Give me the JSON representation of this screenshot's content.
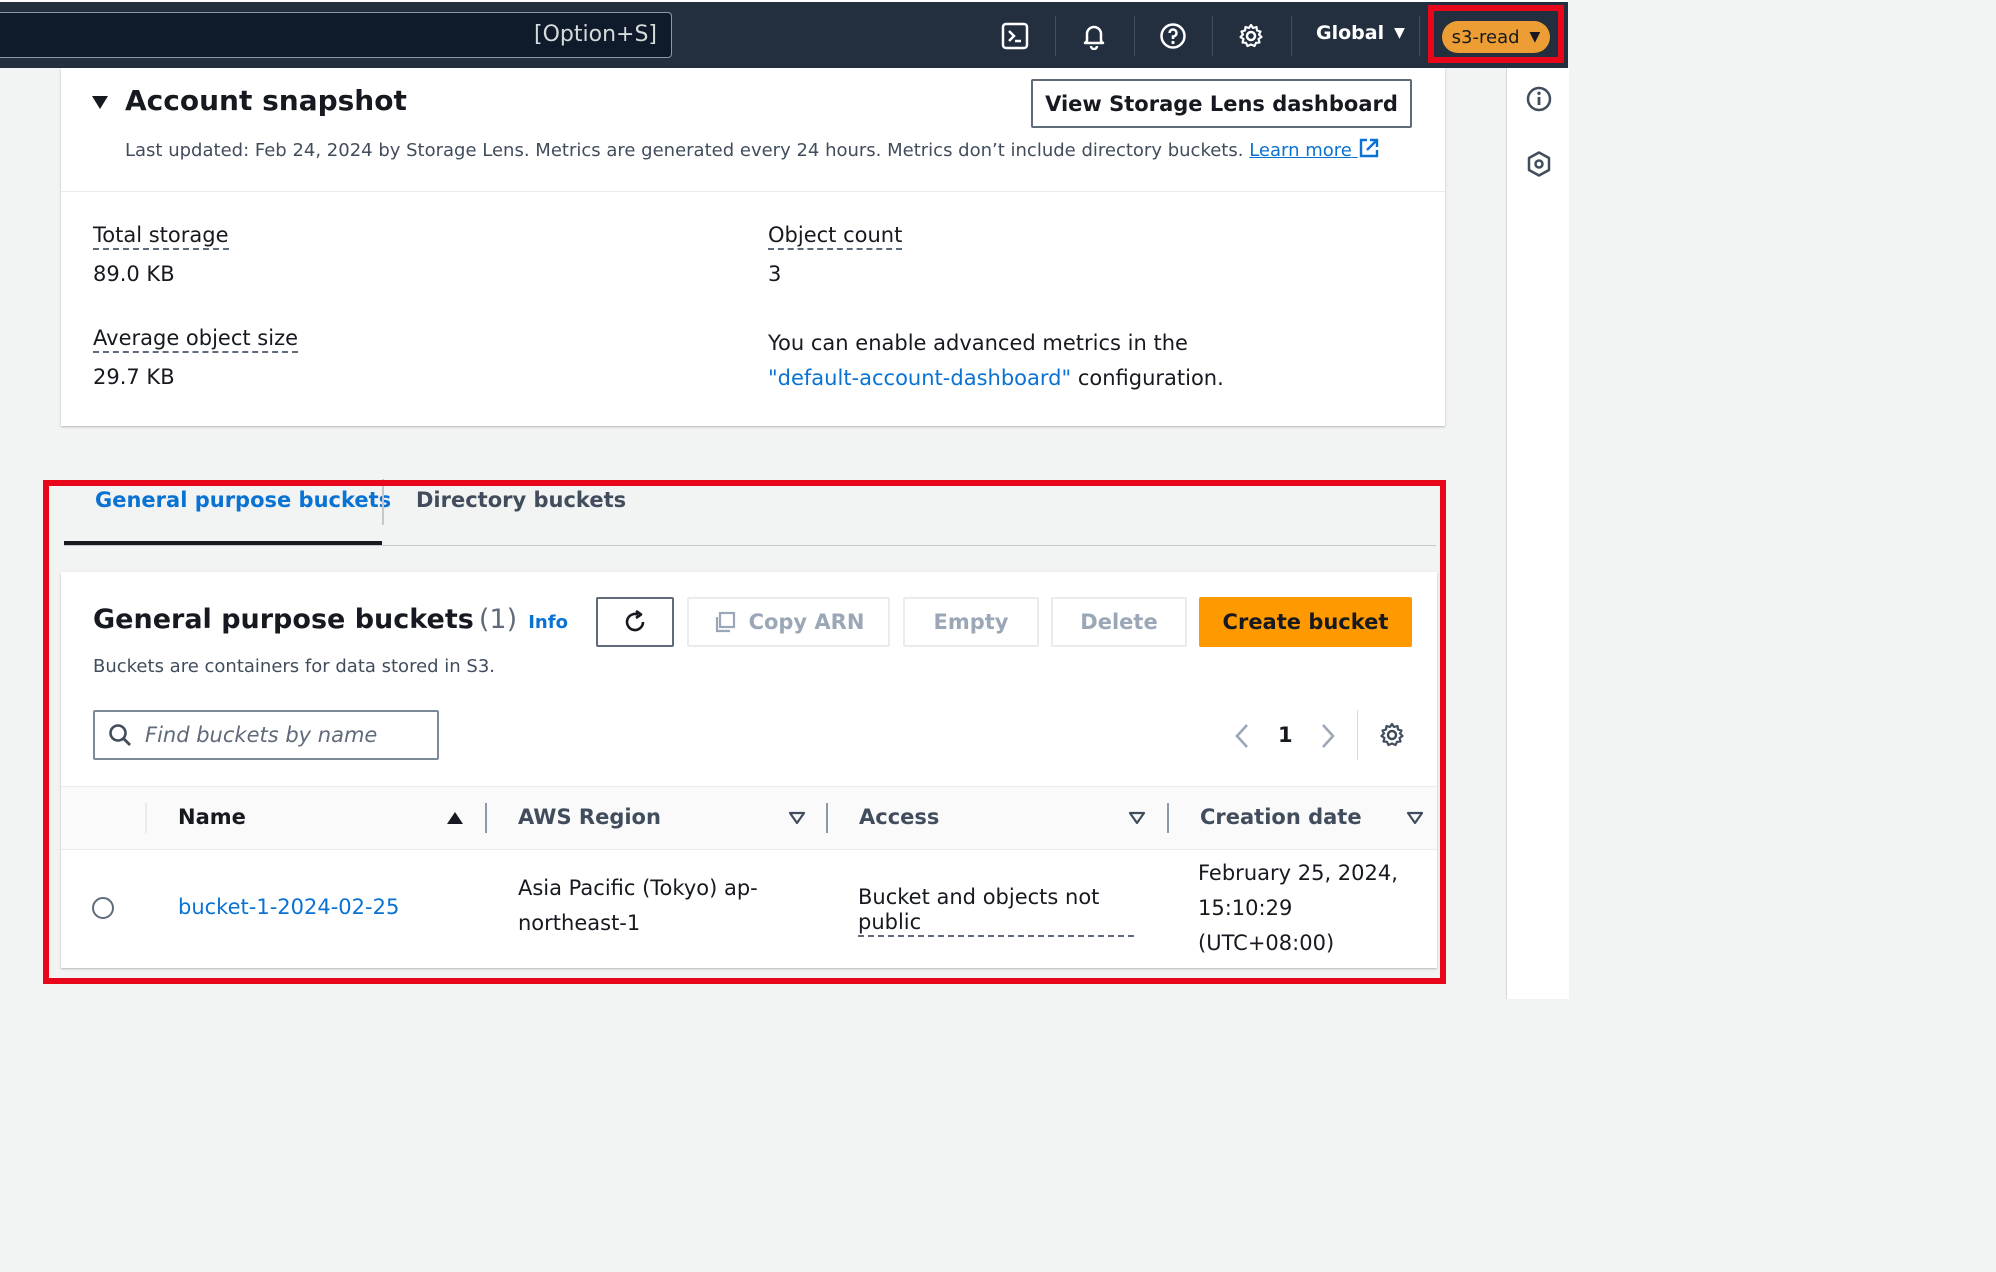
{
  "topnav": {
    "search_shortcut": "[Option+S]",
    "icons": [
      "cloudshell-icon",
      "bell-icon",
      "help-icon",
      "gear-icon"
    ],
    "region_label": "Global",
    "user_label": "s3-read"
  },
  "snapshot": {
    "title": "Account snapshot",
    "view_button": "View Storage Lens dashboard",
    "last_updated": "Last updated: Feb 24, 2024 by Storage Lens. Metrics are generated every 24 hours. Metrics don’t include directory buckets.",
    "learn_more": "Learn more",
    "metrics": {
      "total_storage_label": "Total storage",
      "total_storage_value": "89.0 KB",
      "object_count_label": "Object count",
      "object_count_value": "3",
      "avg_size_label": "Average object size",
      "avg_size_value": "29.7 KB"
    },
    "advanced_text_1": "You can enable advanced metrics in the",
    "advanced_link": "\"default-account-dashboard\"",
    "advanced_text_2": "configuration."
  },
  "tabs": {
    "general": "General purpose buckets",
    "directory": "Directory buckets"
  },
  "buckets": {
    "title": "General purpose buckets",
    "count": "(1)",
    "info": "Info",
    "description": "Buckets are containers for data stored in S3.",
    "copy_arn": "Copy ARN",
    "empty": "Empty",
    "delete": "Delete",
    "create": "Create bucket",
    "search_placeholder": "Find buckets by name",
    "page_number": "1",
    "columns": [
      "Name",
      "AWS Region",
      "Access",
      "Creation date"
    ],
    "rows": [
      {
        "name": "bucket-1-2024-02-25",
        "region_line1": "Asia Pacific (Tokyo) ap-",
        "region_line2": "northeast-1",
        "access_line1": "Bucket and objects not",
        "access_line2": "public",
        "date_line1": "February 25, 2024,",
        "date_line2": "15:10:29",
        "date_line3": "(UTC+08:00)"
      }
    ]
  },
  "colors": {
    "nav_bg": "#232f3e",
    "link": "#0972d3",
    "primary_button": "#ff9900",
    "user_pill": "#ec9e34",
    "highlight": "#e8061b"
  }
}
